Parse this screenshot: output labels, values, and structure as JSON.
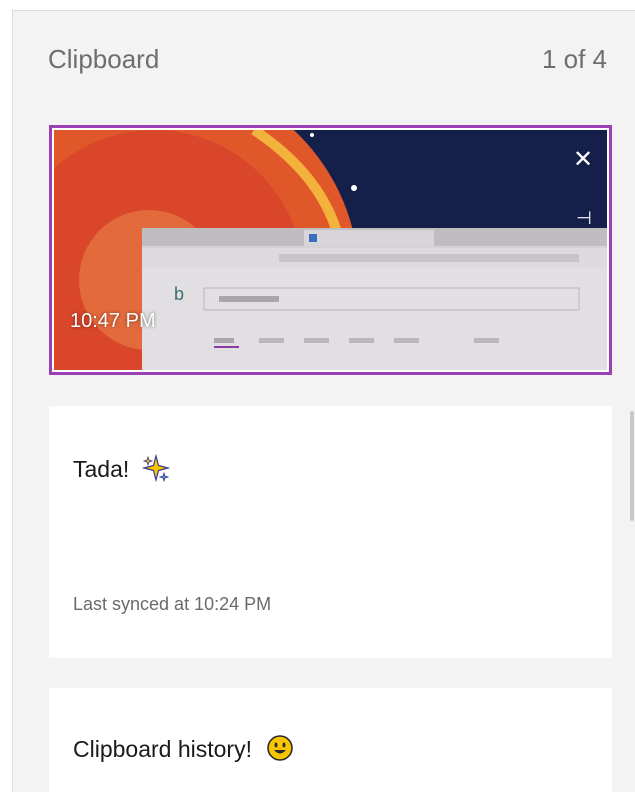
{
  "header": {
    "title": "Clipboard",
    "counter": "1 of 4"
  },
  "items": [
    {
      "type": "image",
      "time": "10:47 PM",
      "close_icon": "close-icon",
      "pin_icon": "pin-icon"
    },
    {
      "type": "text",
      "text": "Tada!",
      "emoji": "sparkles-icon",
      "sync_status": "Last synced at 10:24 PM"
    },
    {
      "type": "text",
      "text": "Clipboard history!",
      "emoji": "smiley-icon"
    }
  ],
  "colors": {
    "selection_border": "#9b3fb5",
    "panel_bg": "#f3f3f3"
  }
}
